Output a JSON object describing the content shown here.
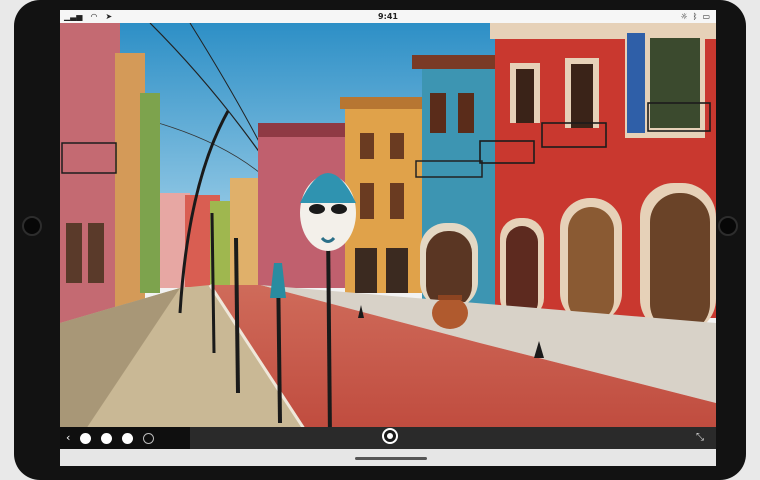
{
  "status_bar": {
    "time": "9:41",
    "left_icons": [
      "signal-icon",
      "wifi-icon",
      "location-icon"
    ],
    "right_icons": [
      "brightness-icon",
      "bluetooth-icon",
      "battery-icon"
    ]
  },
  "scene": {
    "sky_top": "#2d8fc6",
    "sky_bottom": "#a8d4ea",
    "street_color": "#c8554a",
    "wall_red": "#c9382f",
    "wall_teal": "#3d95b2",
    "wall_ochre": "#e0a24a",
    "wall_pink": "#c0606e"
  },
  "toolbar": {
    "back_glyph": "‹",
    "expand_glyph": "⤡",
    "dots": 3
  }
}
